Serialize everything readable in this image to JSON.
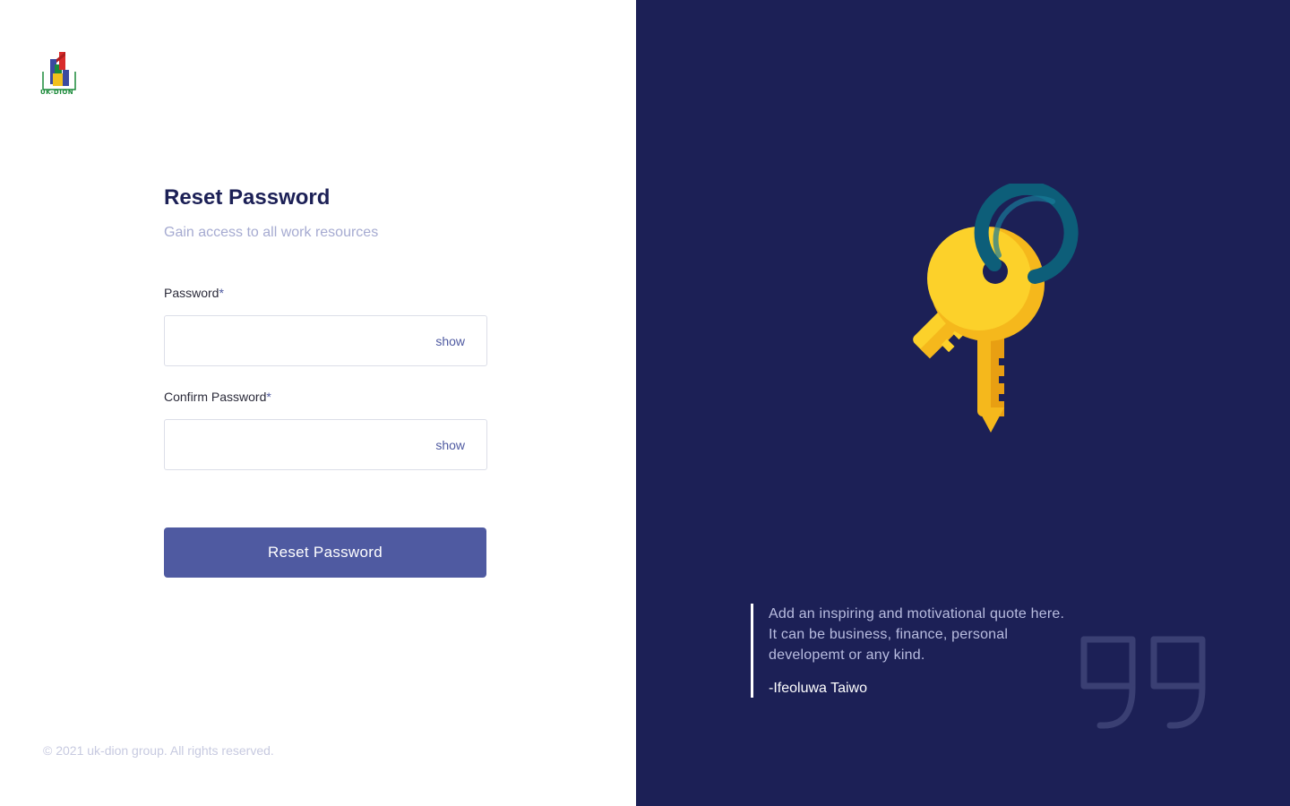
{
  "brand": {
    "logo_text": "UK-DION"
  },
  "form": {
    "title": "Reset Password",
    "subtitle": "Gain access to all work resources",
    "password_label": "Password",
    "confirm_label": "Confirm Password",
    "required_mark": "*",
    "password_value": "",
    "confirm_value": "",
    "show_label": "show",
    "submit_label": "Reset Password"
  },
  "footer": {
    "copyright": "© 2021 uk-dion group. All rights reserved."
  },
  "side": {
    "illustration": "keys-icon",
    "quote": "Add an inspiring and motivational quote here. It can be business, finance, personal developemt or any kind.",
    "author": "-Ifeoluwa Taiwo",
    "quote_mark_icon": "quote-mark-icon"
  },
  "colors": {
    "brand_dark": "#1c2056",
    "accent": "#4f5aa1",
    "muted": "#a6abd1"
  }
}
